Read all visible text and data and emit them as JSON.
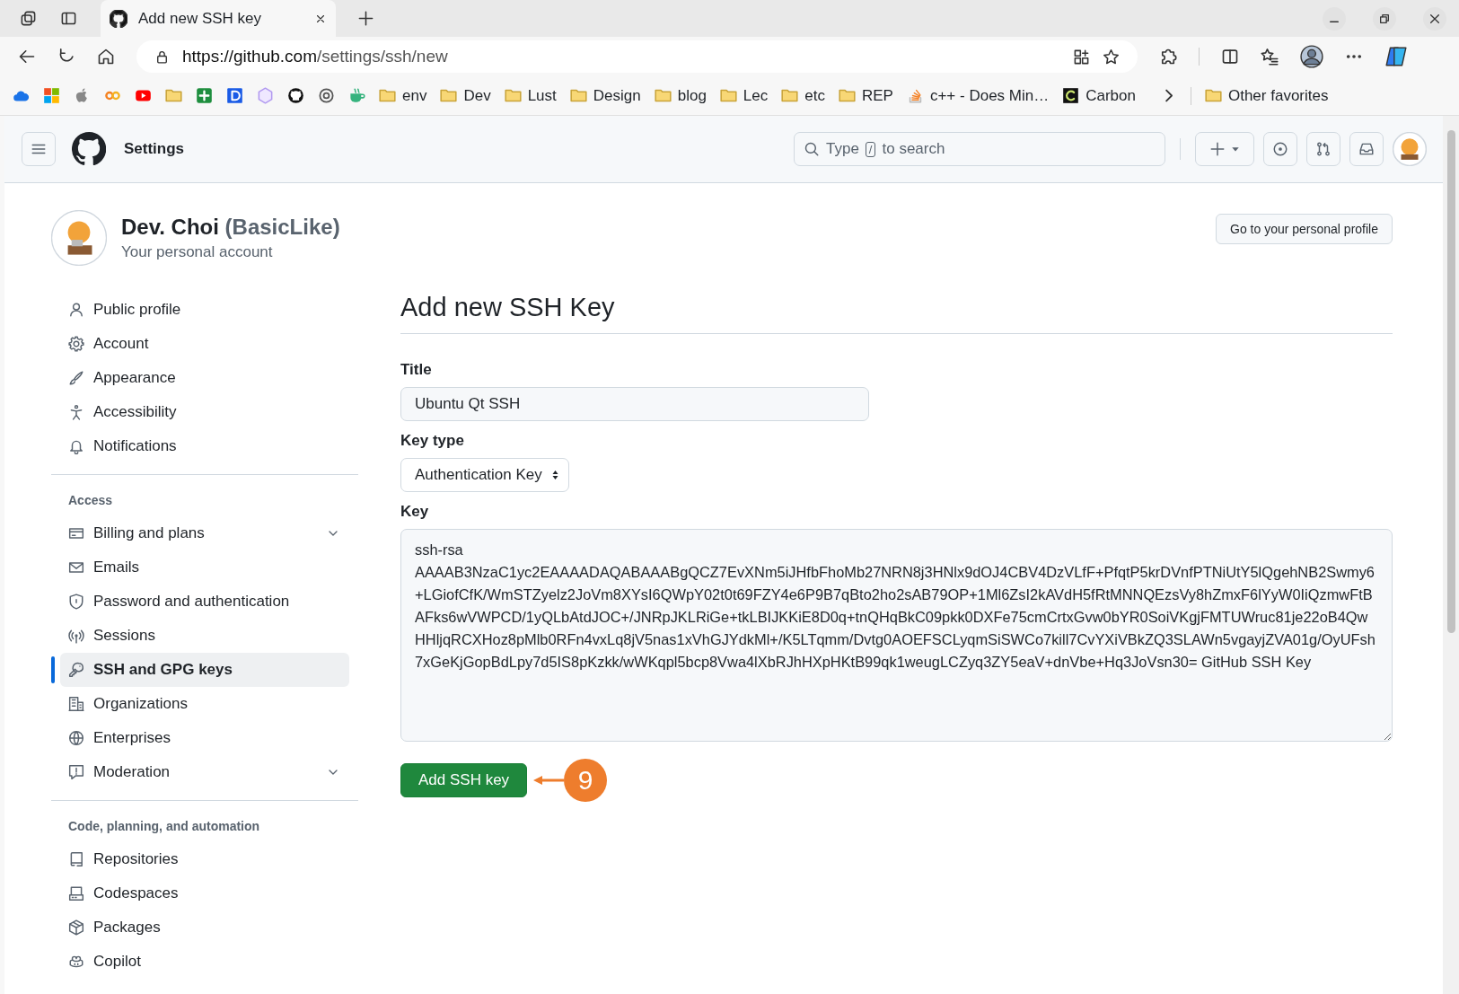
{
  "browser": {
    "tab": {
      "title": "Add new SSH key"
    },
    "url": {
      "host": "https://github.com",
      "path": "/settings/ssh/new"
    },
    "bookmarks": [
      {
        "label": "env",
        "kind": "folder"
      },
      {
        "label": "Dev",
        "kind": "folder"
      },
      {
        "label": "Lust",
        "kind": "folder"
      },
      {
        "label": "Design",
        "kind": "folder"
      },
      {
        "label": "blog",
        "kind": "folder"
      },
      {
        "label": "Lec",
        "kind": "folder"
      },
      {
        "label": "etc",
        "kind": "folder"
      },
      {
        "label": "REP",
        "kind": "folder"
      },
      {
        "label": "c++ - Does Min…",
        "kind": "stack"
      },
      {
        "label": "Carbon",
        "kind": "carbon"
      }
    ],
    "other_favorites": "Other favorites"
  },
  "header": {
    "title": "Settings",
    "search": {
      "before": "Type",
      "key": "/",
      "after": "to search"
    }
  },
  "profile": {
    "name": "Dev. Choi",
    "handle": "(BasicLike)",
    "subtitle": "Your personal account",
    "profile_button": "Go to your personal profile"
  },
  "sidebar": {
    "sections": [
      {
        "items": [
          {
            "label": "Public profile",
            "selected": false,
            "kind": "link"
          },
          {
            "label": "Account",
            "selected": false,
            "kind": "link"
          },
          {
            "label": "Appearance",
            "selected": false,
            "kind": "link"
          },
          {
            "label": "Accessibility",
            "selected": false,
            "kind": "link"
          },
          {
            "label": "Notifications",
            "selected": false,
            "kind": "link"
          }
        ]
      },
      {
        "heading": "Access",
        "items": [
          {
            "label": "Billing and plans",
            "selected": false,
            "kind": "group"
          },
          {
            "label": "Emails",
            "selected": false,
            "kind": "link"
          },
          {
            "label": "Password and authentication",
            "selected": false,
            "kind": "link"
          },
          {
            "label": "Sessions",
            "selected": false,
            "kind": "link"
          },
          {
            "label": "SSH and GPG keys",
            "selected": true,
            "kind": "link"
          },
          {
            "label": "Organizations",
            "selected": false,
            "kind": "link"
          },
          {
            "label": "Enterprises",
            "selected": false,
            "kind": "link"
          },
          {
            "label": "Moderation",
            "selected": false,
            "kind": "group"
          }
        ]
      },
      {
        "heading": "Code, planning, and automation",
        "items": [
          {
            "label": "Repositories",
            "selected": false,
            "kind": "link"
          },
          {
            "label": "Codespaces",
            "selected": false,
            "kind": "link"
          },
          {
            "label": "Packages",
            "selected": false,
            "kind": "link"
          },
          {
            "label": "Copilot",
            "selected": false,
            "kind": "link"
          }
        ]
      }
    ]
  },
  "form": {
    "heading": "Add new SSH Key",
    "title_label": "Title",
    "title_value": "Ubuntu Qt SSH",
    "key_type_label": "Key type",
    "key_type_value": "Authentication Key",
    "key_label": "Key",
    "key_value": "ssh-rsa AAAAB3NzaC1yc2EAAAADAQABAAABgQCZ7EvXNm5iJHfbFhoMb27NRN8j3HNlx9dOJ4CBV4DzVLfF+PfqtP5krDVnfPTNiUtY5lQgehNB2Swmy6+LGiofCfK/WmSTZyelz2JoVm8XYsI6QWpY02t0t69FZY4e6P9B7qBto2ho2sAB79OP+1Ml6ZsI2kAVdH5fRtMNNQEzsVy8hZmxF6lYyW0IiQzmwFtBAFks6wVWPCD/1yQLbAtdJOC+/JNRpJKLRiGe+tkLBIJKKiE8D0q+tnQHqBkC09pkk0DXFe75cmCrtxGvw0bYR0SoiVKgjFMTUWruc81je22oB4QwHHljqRCXHoz8pMlb0RFn4vxLq8jV5nas1xVhGJYdkMl+/K5LTqmm/Dvtg0AOEFSCLyqmSiSWCo7kill7CvYXiVBkZQ3SLAWn5vgayjZVA01g/OyUFsh7xGeKjGopBdLpy7d5IS8pKzkk/wWKqpl5bcp8Vwa4lXbRJhHXpHKtB99qk1weugLCZyq3ZY5eaV+dnVbe+Hq3JoVsn30= GitHub SSH Key",
    "submit": "Add SSH key",
    "annotation": "9"
  }
}
